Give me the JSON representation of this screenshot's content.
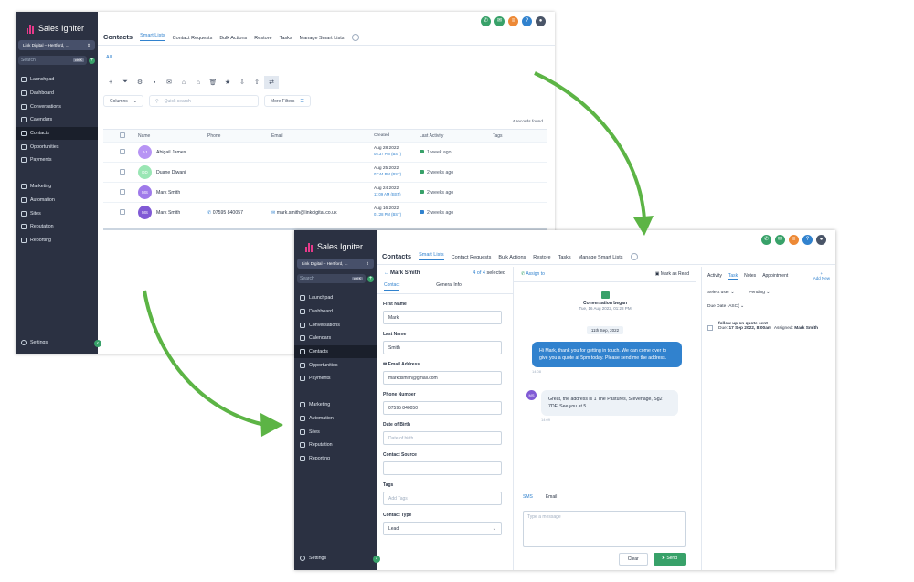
{
  "brand": "Sales Igniter",
  "location": "Link Digital – Hertford, ...",
  "search": {
    "placeholder": "Search",
    "shortcut": "ctrl K"
  },
  "nav": {
    "items": [
      "Launchpad",
      "Dashboard",
      "Conversations",
      "Calendars",
      "Contacts",
      "Opportunities",
      "Payments"
    ],
    "items2": [
      "Marketing",
      "Automation",
      "Sites",
      "Reputation",
      "Reporting"
    ],
    "settings": "Settings"
  },
  "topbar": {
    "title": "Contacts",
    "tabs": [
      "Smart Lists",
      "Contact Requests",
      "Bulk Actions",
      "Restore",
      "Tasks",
      "Manage Smart Lists"
    ]
  },
  "list": {
    "subtab": "All",
    "columns_btn": "Columns",
    "quick_search": "Quick search",
    "more_filters": "More Filters",
    "records": "4 records found",
    "headers": [
      "Name",
      "Phone",
      "Email",
      "Created",
      "Last Activity",
      "Tags"
    ],
    "rows": [
      {
        "initials": "AJ",
        "color": "#b794f4",
        "name": "Abigail James",
        "phone": "",
        "email": "",
        "created": "Aug 28 2022",
        "time": "05:37 PM (BST)",
        "activity": "1 week ago"
      },
      {
        "initials": "DD",
        "color": "#9ae6b4",
        "name": "Duane Diwani",
        "phone": "",
        "email": "",
        "created": "Aug 25 2022",
        "time": "07:44 PM (BST)",
        "activity": "2 weeks ago"
      },
      {
        "initials": "MS",
        "color": "#9f7aea",
        "name": "Mark Smith",
        "phone": "",
        "email": "",
        "created": "Aug 24 2022",
        "time": "11:09 AM (BST)",
        "activity": "2 weeks ago"
      },
      {
        "initials": "MS",
        "color": "#805ad5",
        "name": "Mark Smith",
        "phone": "07595 840057",
        "email": "mark.smith@linkdigital.co.uk",
        "created": "Aug 16 2022",
        "time": "01:28 PM (BST)",
        "activity": "2 weeks ago"
      }
    ]
  },
  "detail": {
    "name": "Mark Smith",
    "pager": "4 of 4",
    "selected": "selected",
    "tabs": [
      "Contact",
      "General Info"
    ],
    "fields": [
      {
        "label": "First Name",
        "value": "Mark"
      },
      {
        "label": "Last Name",
        "value": "Smith"
      },
      {
        "label": "Email Address",
        "value": "markdsmith@gmail.com"
      },
      {
        "label": "Phone Number",
        "value": "07595 840050"
      },
      {
        "label": "Date of Birth",
        "value": "",
        "placeholder": "Date of birth"
      },
      {
        "label": "Contact Source",
        "value": ""
      },
      {
        "label": "Tags",
        "value": "",
        "placeholder": "Add Tags"
      },
      {
        "label": "Contact Type",
        "value": "Lead"
      }
    ]
  },
  "conversation": {
    "assign": "Assign to",
    "mark_read": "Mark as Read",
    "began": "Conversation began",
    "began_date": "Tue, 16 Aug 2022, 01:28 PM",
    "date_pill": "11th Sep, 2022",
    "msg_out": "Hi Mark, thank you for getting in touch. We can come over to give you a quote at 5pm today. Please send me the address.",
    "msg_out_time": "14:08",
    "msg_in": "Great, the address is 1 The Pastures, Stevenage, Sg2 7DF. See you at 5",
    "msg_in_time": "14:09",
    "in_initials": "MS",
    "compose_tabs": [
      "SMS",
      "Email"
    ],
    "compose_placeholder": "Type a message",
    "clear": "Clear",
    "send": "Send"
  },
  "side": {
    "tabs": [
      "Activity",
      "Task",
      "Notes",
      "Appointment"
    ],
    "add": "Add New",
    "select_user": "Select user",
    "pending": "Pending",
    "due_sort": "Due Date (ASC)",
    "task_title": "follow up on quote sent",
    "task_due_label": "Due:",
    "task_due": "17 Sep 2022, 8:00am",
    "task_assigned_label": "Assigned:",
    "task_assigned": "Mark Smith"
  }
}
